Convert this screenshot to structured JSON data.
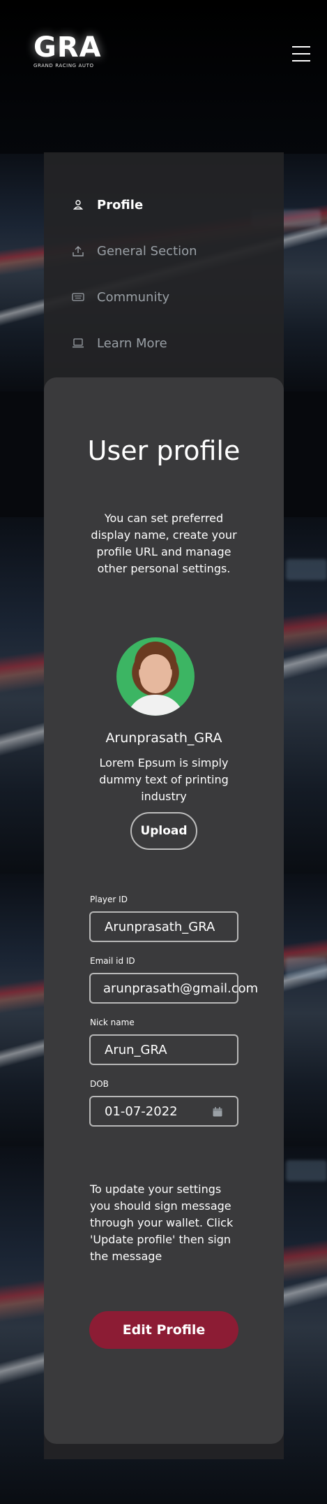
{
  "brand": {
    "logo_text": "GRA",
    "tagline": "GRAND RACING AUTO"
  },
  "header": {
    "menu_icon": "hamburger-menu-icon"
  },
  "nav": {
    "items": [
      {
        "label": "Profile",
        "icon": "user-icon",
        "active": true
      },
      {
        "label": "General Section",
        "icon": "upload-icon",
        "active": false
      },
      {
        "label": "Community",
        "icon": "keyboard-icon",
        "active": false
      },
      {
        "label": "Learn More",
        "icon": "laptop-icon",
        "active": false
      }
    ]
  },
  "profile": {
    "title": "User profile",
    "description": "You can set preferred display name, create your profile URL and manage other personal settings.",
    "username": "Arunprasath_GRA",
    "bio": "Lorem Epsum is simply dummy text of printing industry",
    "upload_label": "Upload"
  },
  "form": {
    "player_id": {
      "label": "Player ID",
      "value": "Arunprasath_GRA"
    },
    "email": {
      "label": "Email id ID",
      "value": "arunprasath@gmail.com"
    },
    "nick_name": {
      "label": "Nick name",
      "value": "Arun_GRA"
    },
    "dob": {
      "label": "DOB",
      "value": "01-07-2022"
    }
  },
  "footer_note": "To update your settings you should sign message through your wallet. Click 'Update profile' then sign the message",
  "edit_button_label": "Edit Profile",
  "colors": {
    "accent": "#8c1c34",
    "panel": "#242426",
    "card": "#3a3a3c"
  }
}
